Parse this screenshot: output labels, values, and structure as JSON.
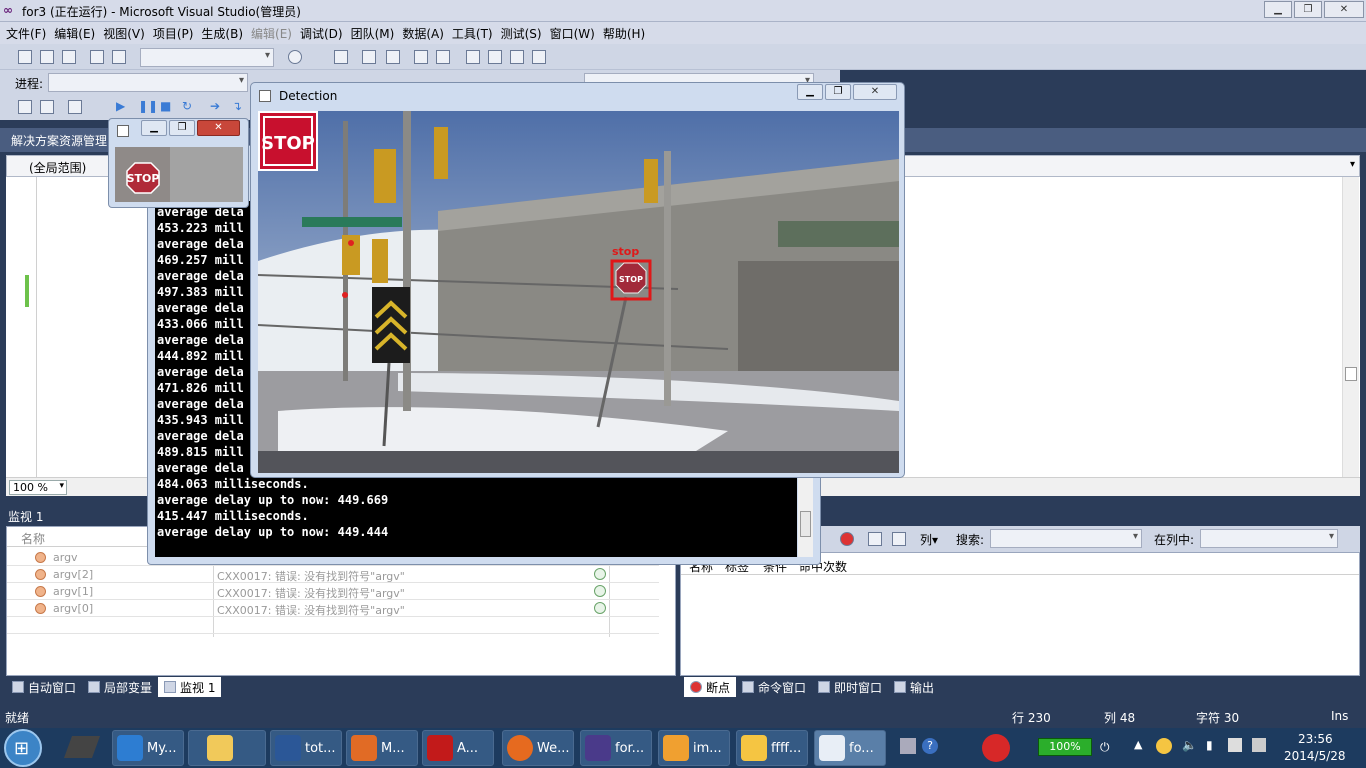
{
  "window": {
    "title": "for3 (正在运行) - Microsoft Visual Studio(管理员)"
  },
  "menu": [
    "文件(F)",
    "编辑(E)",
    "视图(V)",
    "项目(P)",
    "生成(B)",
    "编辑(E)",
    "调试(D)",
    "团队(M)",
    "数据(A)",
    "工具(T)",
    "测试(S)",
    "窗口(W)",
    "帮助(H)"
  ],
  "toolbar2": {
    "process_label": "进程:"
  },
  "solution_explorer": {
    "title": "解决方案资源管理",
    "scope": "(全局范围)"
  },
  "editor": {
    "zoom": "100 %"
  },
  "console_lines": [
    "average dela",
    "453.223 mill",
    "average dela",
    "469.257 mill",
    "average dela",
    "497.383 mill",
    "average dela",
    "433.066 mill",
    "average dela",
    "444.892 mill",
    "average dela",
    "471.826 mill",
    "average dela",
    "435.943 mill",
    "average dela",
    "489.815 mill",
    "average dela",
    "484.063 milliseconds.",
    "average delay up to now: 449.669",
    "415.447 milliseconds.",
    "average delay up to now: 449.444"
  ],
  "detection_window": {
    "title": "Detection",
    "stop_text": "STOP",
    "detect_label": "stop"
  },
  "watch": {
    "title": "监视 1",
    "col_name": "名称",
    "rows": [
      {
        "name": "argv",
        "value": ""
      },
      {
        "name": "argv[2]",
        "value": "CXX0017: 错误: 没有找到符号\"argv\""
      },
      {
        "name": "argv[1]",
        "value": "CXX0017: 错误: 没有找到符号\"argv\""
      },
      {
        "name": "argv[0]",
        "value": "CXX0017: 错误: 没有找到符号\"argv\""
      }
    ]
  },
  "breakpoints": {
    "toolbar": {
      "columns": "列▾",
      "search": "搜索:",
      "in_column": "在列中:"
    },
    "headers": [
      "名称",
      "标签",
      "条件",
      "命中次数"
    ]
  },
  "left_tabs": [
    "自动窗口",
    "局部变量",
    "监视 1"
  ],
  "right_tabs": [
    "断点",
    "命令窗口",
    "即时窗口",
    "输出"
  ],
  "status": {
    "text": "就绪",
    "line": "行 230",
    "col": "列 48",
    "char": "字符 30",
    "mode": "Ins"
  },
  "taskbar": {
    "items": [
      {
        "label": "My..."
      },
      {
        "label": ""
      },
      {
        "label": "tot..."
      },
      {
        "label": "M..."
      },
      {
        "label": "A..."
      },
      {
        "label": "We..."
      },
      {
        "label": "for..."
      },
      {
        "label": "im..."
      },
      {
        "label": "ffff..."
      },
      {
        "label": "fo..."
      }
    ],
    "battery": "100%",
    "time": "23:56",
    "date": "2014/5/28"
  }
}
